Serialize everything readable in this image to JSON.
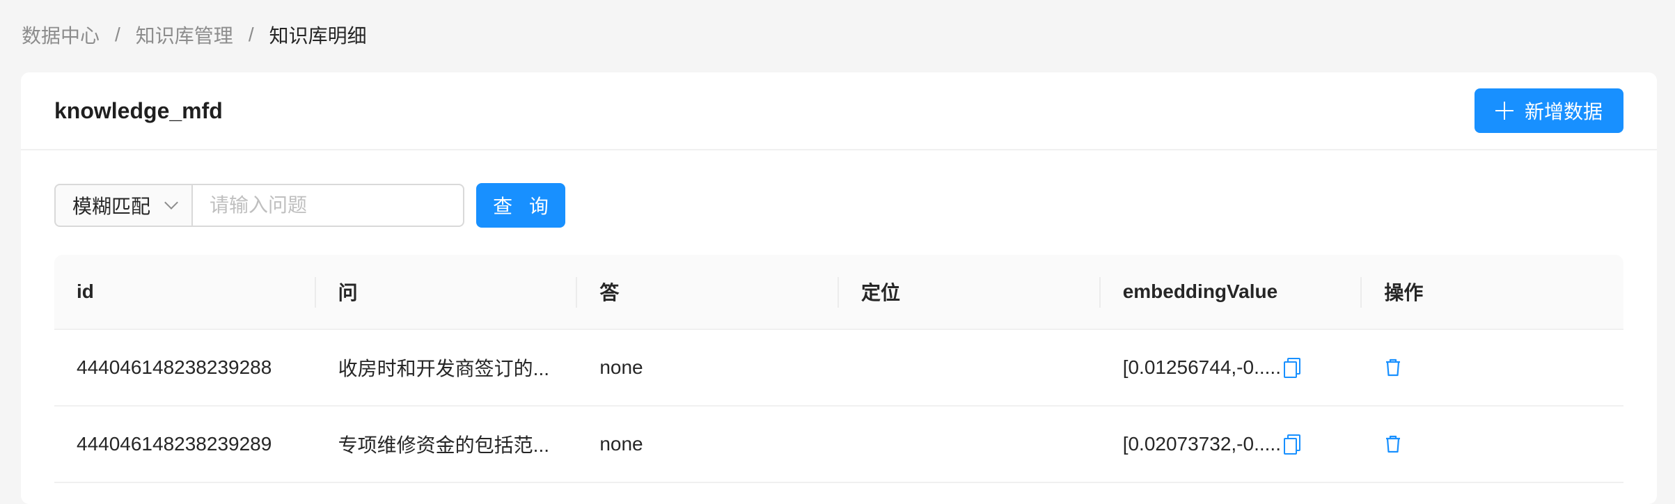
{
  "breadcrumb": {
    "items": [
      "数据中心",
      "知识库管理",
      "知识库明细"
    ],
    "separator": "/"
  },
  "card": {
    "title": "knowledge_mfd",
    "add_button_label": "新增数据"
  },
  "filter": {
    "match_mode": "模糊匹配",
    "search_placeholder": "请输入问题",
    "search_value": "",
    "query_button_label": "查 询"
  },
  "table": {
    "columns": [
      "id",
      "问",
      "答",
      "定位",
      "embeddingValue",
      "操作"
    ],
    "rows": [
      {
        "id": "444046148238239288",
        "question": "收房时和开发商签订的...",
        "answer": "none",
        "location": "",
        "embedding": "[0.01256744,-0....."
      },
      {
        "id": "444046148238239289",
        "question": "专项维修资金的包括范...",
        "answer": "none",
        "location": "",
        "embedding": "[0.02073732,-0....."
      }
    ]
  },
  "colors": {
    "primary": "#1890ff",
    "page_bg": "#f5f5f5"
  },
  "icons": [
    "plus-icon",
    "chevron-down-icon",
    "copy-icon",
    "trash-icon"
  ]
}
